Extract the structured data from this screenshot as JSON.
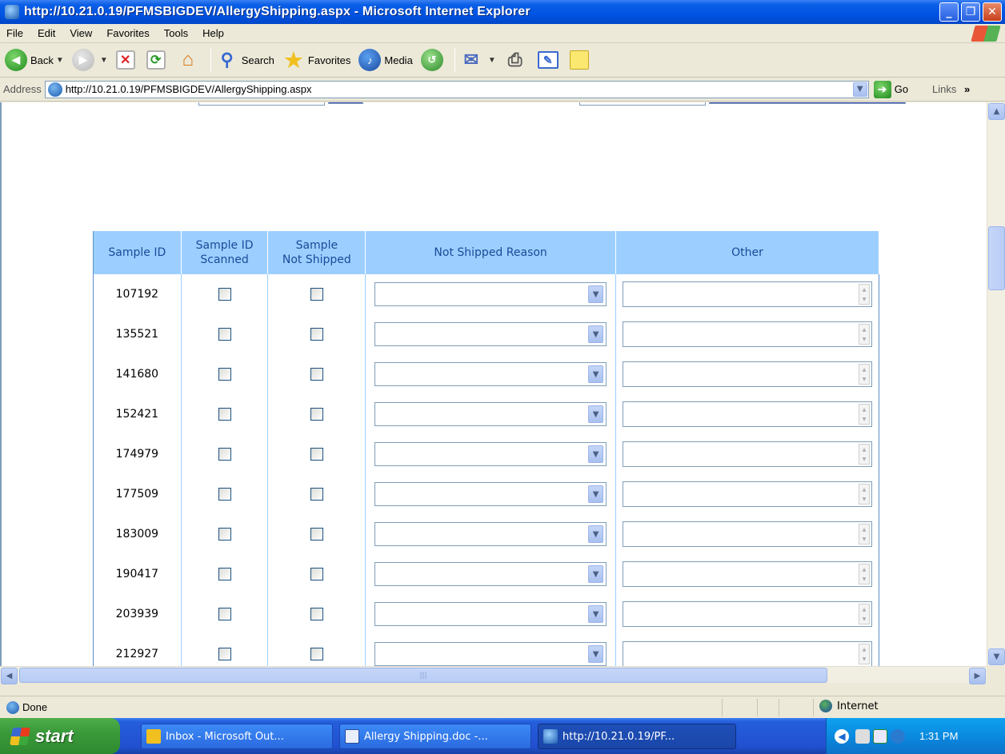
{
  "window": {
    "title": "http://10.21.0.19/PFMSBIGDEV/AllergyShipping.aspx - Microsoft Internet Explorer",
    "minimize_icon": "minimize-icon",
    "maximize_icon": "maximize-icon",
    "close_icon": "close-icon"
  },
  "menubar": {
    "items": [
      "File",
      "Edit",
      "View",
      "Favorites",
      "Tools",
      "Help"
    ]
  },
  "toolbar": {
    "back": "Back",
    "search": "Search",
    "favorites": "Favorites",
    "media": "Media"
  },
  "address": {
    "label": "Address",
    "url": "http://10.21.0.19/PFMSBIGDEV/AllergyShipping.aspx",
    "go": "Go",
    "links": "Links",
    "more": "»"
  },
  "grid": {
    "headers": {
      "sample_id": "Sample ID",
      "scanned_line1": "Sample ID",
      "scanned_line2": "Scanned",
      "not_shipped_line1": "Sample",
      "not_shipped_line2": "Not Shipped",
      "reason": "Not Shipped Reason",
      "other": "Other"
    },
    "rows": [
      {
        "id": "107192"
      },
      {
        "id": "135521"
      },
      {
        "id": "141680"
      },
      {
        "id": "152421"
      },
      {
        "id": "174979"
      },
      {
        "id": "177509"
      },
      {
        "id": "183009"
      },
      {
        "id": "190417"
      },
      {
        "id": "203939"
      },
      {
        "id": "212927"
      }
    ]
  },
  "status": {
    "text": "Done",
    "zone": "Internet"
  },
  "taskbar": {
    "start": "start",
    "tasks": [
      "Inbox - Microsoft Out...",
      "Allergy Shipping.doc -...",
      "http://10.21.0.19/PF..."
    ],
    "clock": "1:31 PM"
  },
  "colors": {
    "grid_header_bg": "#9ccfff",
    "grid_header_text": "#1a4a9a",
    "titlebar": "#0054e3",
    "taskbar": "#245edb",
    "start_button": "#3a9a3a"
  }
}
